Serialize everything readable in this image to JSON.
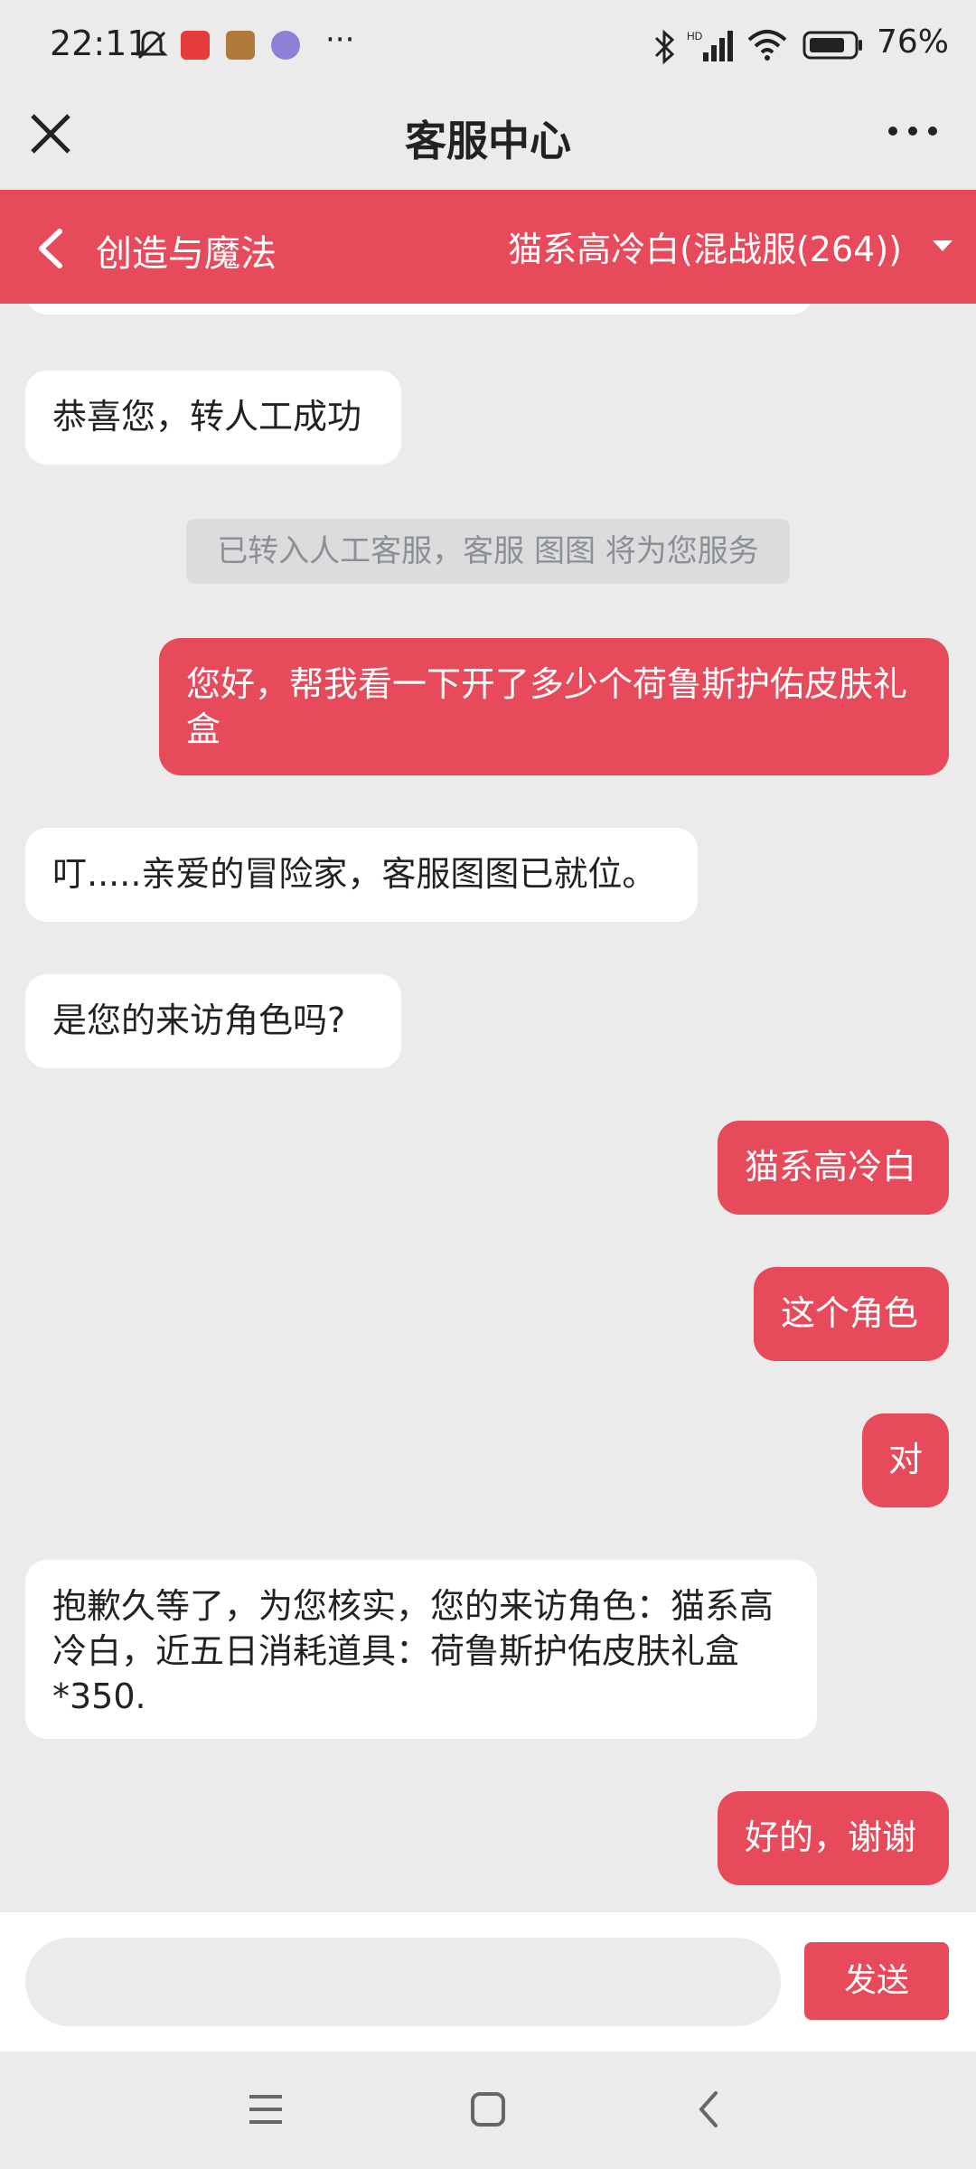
{
  "status_bar": {
    "time": "22:11",
    "battery": "76%"
  },
  "header": {
    "title": "客服中心"
  },
  "game_bar": {
    "game_name": "创造与魔法",
    "server": "猫系高冷白(混战服(264))"
  },
  "messages": {
    "m0": "恭喜您，转人工成功",
    "m1": "已转入人工客服，客服 图图 将为您服务",
    "m2": "您好，帮我看一下开了多少个荷鲁斯护佑皮肤礼盒",
    "m3": "叮.....亲爱的冒险家，客服图图已就位。",
    "m4": "是您的来访角色吗?",
    "m5": "猫系高冷白",
    "m6": "这个角色",
    "m7": "对",
    "m8": "抱歉久等了，为您核实，您的来访角色：猫系高冷白，近五日消耗道具：荷鲁斯护佑皮肤礼盒*350.",
    "m9": "好的，谢谢"
  },
  "composer": {
    "input_value": "",
    "send_label": "发送"
  },
  "colors": {
    "accent": "#e64a5b",
    "background": "#ebebeb",
    "bubble_left": "#ffffff"
  },
  "icons": [
    "close-icon",
    "more-icon",
    "back-icon",
    "dropdown-icon",
    "menu-icon",
    "home-icon",
    "nav-back-icon",
    "bluetooth-icon",
    "signal-icon",
    "wifi-icon",
    "battery-icon",
    "mute-icon"
  ]
}
